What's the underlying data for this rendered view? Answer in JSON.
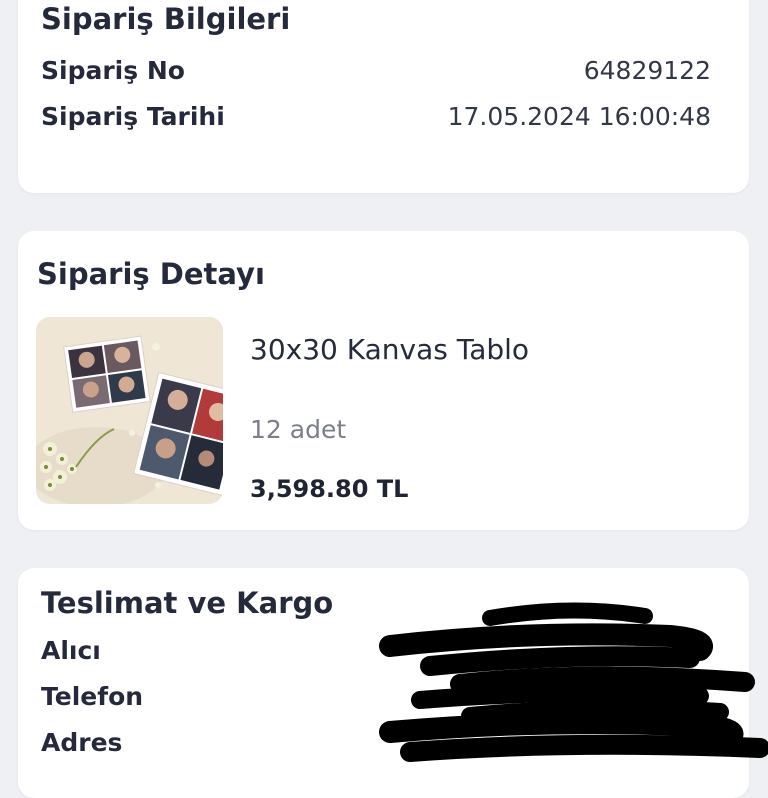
{
  "order_info": {
    "title": "Sipariş Bilgileri",
    "rows": [
      {
        "label": "Sipariş No",
        "value": "64829122"
      },
      {
        "label": "Sipariş Tarihi",
        "value": "17.05.2024 16:00:48"
      }
    ]
  },
  "order_detail": {
    "title": "Sipariş Detayı",
    "product": {
      "name": "30x30 Kanvas Tablo",
      "quantity": "12 adet",
      "price": "3,598.80 TL"
    }
  },
  "delivery": {
    "title": "Teslimat ve Kargo",
    "rows": [
      {
        "label": "Alıcı"
      },
      {
        "label": "Telefon"
      },
      {
        "label": "Adres"
      }
    ]
  },
  "colors": {
    "background": "#eef0f3",
    "card": "#ffffff",
    "text": "#242a3c",
    "muted": "#7b7f88",
    "redaction": "#000000"
  }
}
